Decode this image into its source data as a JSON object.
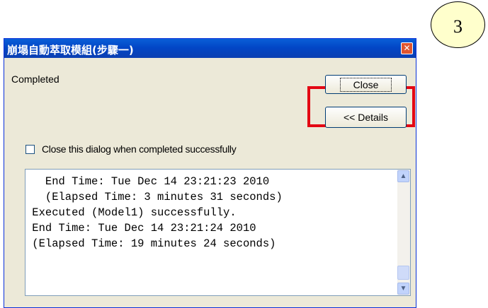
{
  "annotation": {
    "step_number": "3"
  },
  "dialog": {
    "title": "崩塌自動萃取模組(步驟一)",
    "close_x": "✕",
    "status_text": "Completed",
    "close_button_label": "Close",
    "details_button_label": "<< Details",
    "checkbox_label": "Close this dialog when completed successfully",
    "checkbox_checked": false,
    "log_lines": [
      "   End Time: Tue Dec 14 23:21:23 2010",
      "   (Elapsed Time: 3 minutes 31 seconds)",
      " Executed (Model1) successfully.",
      " End Time: Tue Dec 14 23:21:24 2010",
      " (Elapsed Time: 19 minutes 24 seconds)"
    ],
    "scroll_up_icon": "▲",
    "scroll_down_icon": "▼"
  },
  "colors": {
    "titlebar": "#0a4fd0",
    "highlight_box": "#e30613",
    "step_circle_fill": "#ffffcc"
  }
}
